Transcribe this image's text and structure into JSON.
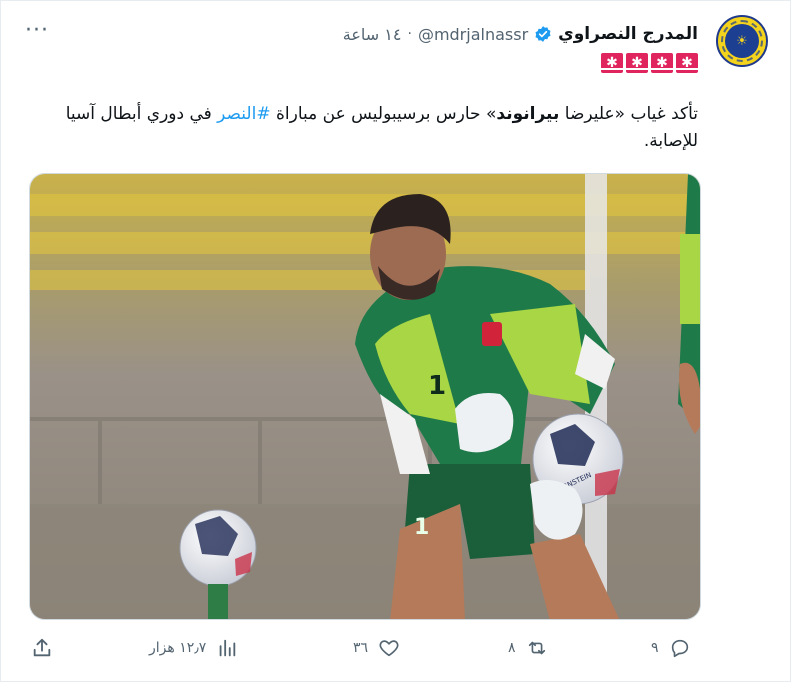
{
  "tweet": {
    "display_name": "المدرج النصراوي",
    "handle": "@mdrjalnassr",
    "separator": "·",
    "time": "١٤ ساعة",
    "more_label": "···",
    "flag_glyph": "✱",
    "flag_count": 4,
    "text": {
      "p1": "تأكد غياب «عليرضا ",
      "bold": "بيرانوند",
      "p2": "» حارس برسيبوليس عن مباراة ",
      "hashtag": "#النصر",
      "p3": " في دوري أبطال آسيا للإصابة."
    },
    "image": {
      "jersey_number": "1",
      "ball_text": "KERNSTEIN"
    },
    "actions": {
      "views": "١٢٫٧ هزار",
      "likes": "٣٦",
      "retweets": "٨",
      "replies": "٩"
    }
  },
  "colors": {
    "link": "#1d9bf0",
    "muted": "#536471",
    "flag_red": "#e0245e",
    "verified_blue": "#1d9bf0",
    "jersey_green": "#1f7a4a",
    "jersey_lime": "#a8d645",
    "stadium_yellow": "#e3c63e"
  }
}
